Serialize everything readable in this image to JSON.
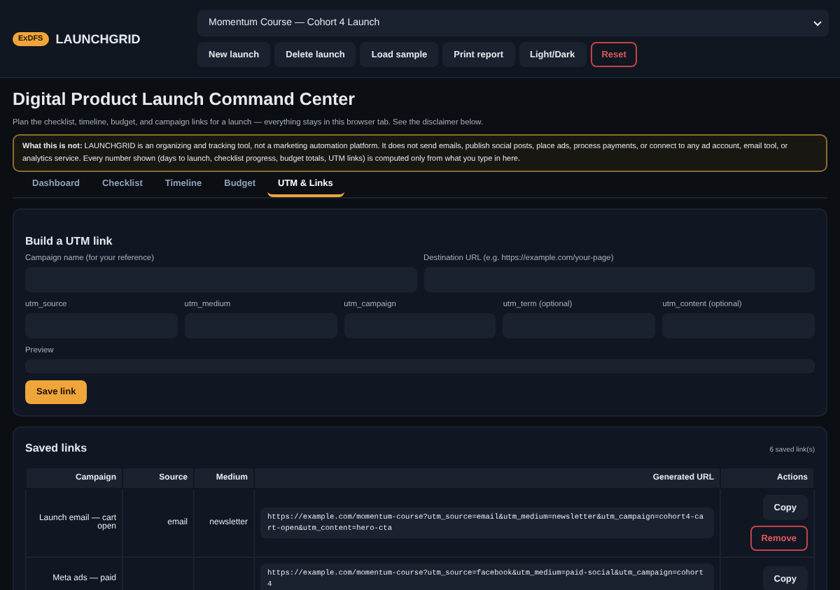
{
  "brand": {
    "badge": "ExDFS",
    "name": "LAUNCHGRID"
  },
  "launch_select": {
    "value": "Momentum Course — Cohort 4 Launch"
  },
  "toolbar": [
    {
      "label": "New launch",
      "kind": "normal"
    },
    {
      "label": "Delete launch",
      "kind": "normal"
    },
    {
      "label": "Load sample",
      "kind": "normal"
    },
    {
      "label": "Print report",
      "kind": "normal"
    },
    {
      "label": "Light/Dark",
      "kind": "normal"
    },
    {
      "label": "Reset",
      "kind": "danger"
    }
  ],
  "page": {
    "title": "Digital Product Launch Command Center",
    "subtitle": "Plan the checklist, timeline, budget, and campaign links for a launch — everything stays in this browser tab. See the disclaimer below."
  },
  "notice": "**What this is not:** LAUNCHGRID is an organizing and tracking tool, not a marketing automation platform. It does not send emails, publish social posts, place ads, process payments, or connect to any ad account, email tool, or analytics service. Every number shown (days to launch, checklist progress, budget totals, UTM links) is computed only from what you type in here.",
  "tabs": [
    {
      "label": "Dashboard",
      "selected": false
    },
    {
      "label": "Checklist",
      "selected": false
    },
    {
      "label": "Timeline",
      "selected": false
    },
    {
      "label": "Budget",
      "selected": false
    },
    {
      "label": "UTM & Links",
      "selected": true
    }
  ],
  "builder": {
    "title": "Build a UTM link",
    "wide_fields": [
      {
        "label": "Campaign name (for your reference)"
      },
      {
        "label": "Destination URL (e.g. https://example.com/your-page)"
      }
    ],
    "fields": [
      {
        "label": "utm_source"
      },
      {
        "label": "utm_medium"
      },
      {
        "label": "utm_campaign"
      },
      {
        "label": "utm_term (optional)"
      },
      {
        "label": "utm_content (optional)"
      }
    ],
    "preview_label": "Preview",
    "save_button": "Save link"
  },
  "saved": {
    "title": "Saved links",
    "count": "6 saved link(s)",
    "columns": [
      "Campaign",
      "Source",
      "Medium",
      "Generated URL",
      "Actions"
    ],
    "rows": [
      {
        "campaign": "Launch email — cart open",
        "source": "email",
        "medium": "newsletter",
        "url": "https://example.com/momentum-course?utm_source=email&utm_medium=newsletter&utm_campaign=cohort4-cart-open&utm_content=hero-cta",
        "actions": [
          "Copy",
          "Remove"
        ]
      },
      {
        "campaign": "Meta ads — paid",
        "source": "",
        "medium": "",
        "url": "https://example.com/momentum-course?utm_source=facebook&utm_medium=paid-social&utm_campaign=cohort4",
        "actions": [
          "Copy"
        ]
      }
    ]
  }
}
